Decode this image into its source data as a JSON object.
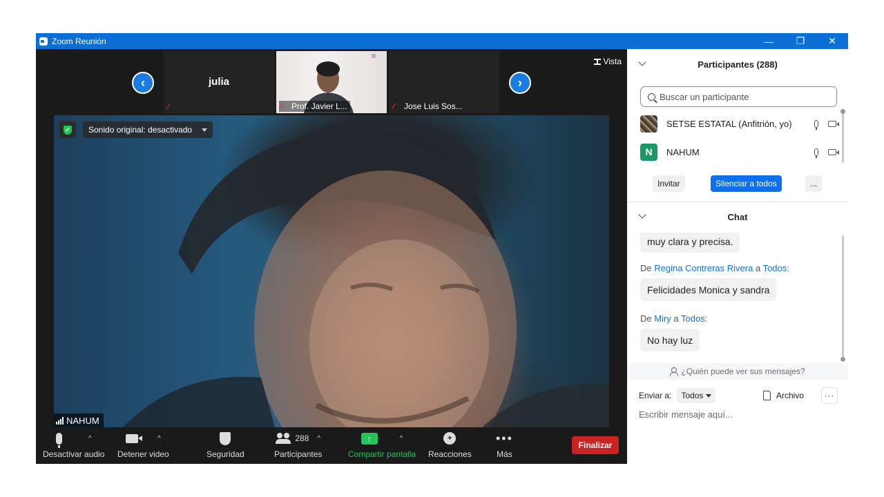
{
  "window": {
    "title": "Zoom Reunión",
    "minimize": "—",
    "restore": "❐",
    "close": "✕"
  },
  "thumbnails": [
    {
      "name_big": "julia",
      "label": ""
    },
    {
      "label": "Prof. Javier L..."
    },
    {
      "label": "Jose Luis Sos..."
    }
  ],
  "view_button": "Vista",
  "nav": {
    "prev": "‹",
    "next": "›"
  },
  "main_video": {
    "sound_label": "Sonido original: desactivado",
    "name_tag": "NAHUM"
  },
  "toolbar": {
    "audio": "Desactivar audio",
    "video": "Detener video",
    "security": "Seguridad",
    "participants": "Participantes",
    "participants_count": "288",
    "share": "Compartir pantalla",
    "share_symbol": "↑",
    "reactions": "Reacciones",
    "reactions_symbol": "+",
    "more": "Más",
    "more_symbol": "•••",
    "end": "Finalizar",
    "caret": "^"
  },
  "participants_panel": {
    "title": "Participantes (288)",
    "search_placeholder": "Buscar un participante",
    "list": [
      {
        "name": "SETSE ESTATAL (Anfitrión, yo)"
      },
      {
        "initial": "N",
        "name": "NAHUM"
      }
    ],
    "invite": "Invitar",
    "mute_all": "Silenciar a todos",
    "more": "..."
  },
  "chat": {
    "title": "Chat",
    "messages": [
      {
        "text": "muy clara y precisa."
      },
      {
        "from_prefix": "De",
        "sender": "Regina Contreras Rivera",
        "to_prefix": "a",
        "recipient": "Todos:",
        "text": "Felicidades Monica y sandra"
      },
      {
        "from_prefix": "De",
        "sender": "Miry",
        "to_prefix": "a",
        "recipient": "Todos:",
        "text": "No hay luz"
      }
    ],
    "who_sees": "¿Quién puede ver sus mensajes?",
    "send_to_label": "Enviar a:",
    "send_to_value": "Todos",
    "file_label": "Archivo",
    "more": "···",
    "input_placeholder": "Escribir mensaje aquí..."
  },
  "colors": {
    "zoom_blue": "#0b6fd6",
    "button_blue": "#0e71eb",
    "end_red": "#c92424",
    "share_green": "#23c55b"
  }
}
